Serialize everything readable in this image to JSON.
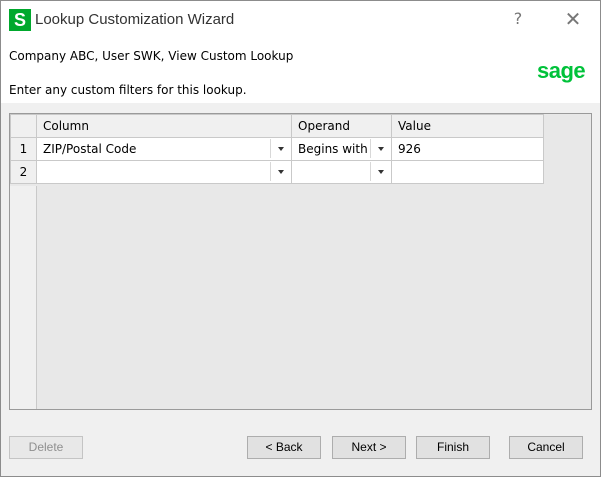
{
  "window": {
    "title": "Lookup Customization Wizard",
    "app_icon_letter": "S",
    "help_symbol": "?",
    "close_symbol": "✕"
  },
  "header": {
    "context": "Company ABC, User SWK, View Custom Lookup",
    "instruction": "Enter any custom filters for this lookup.",
    "logo_text": "sage"
  },
  "grid": {
    "columns": [
      "Column",
      "Operand",
      "Value"
    ],
    "rows": [
      {
        "num": "1",
        "column": "ZIP/Postal Code",
        "operand": "Begins with",
        "value": "926"
      },
      {
        "num": "2",
        "column": "",
        "operand": "",
        "value": ""
      }
    ]
  },
  "buttons": {
    "delete": "Delete",
    "back": "< Back",
    "next": "Next >",
    "finish": "Finish",
    "cancel": "Cancel"
  },
  "colors": {
    "sage_green": "#00c23a",
    "icon_green": "#00a82d"
  }
}
